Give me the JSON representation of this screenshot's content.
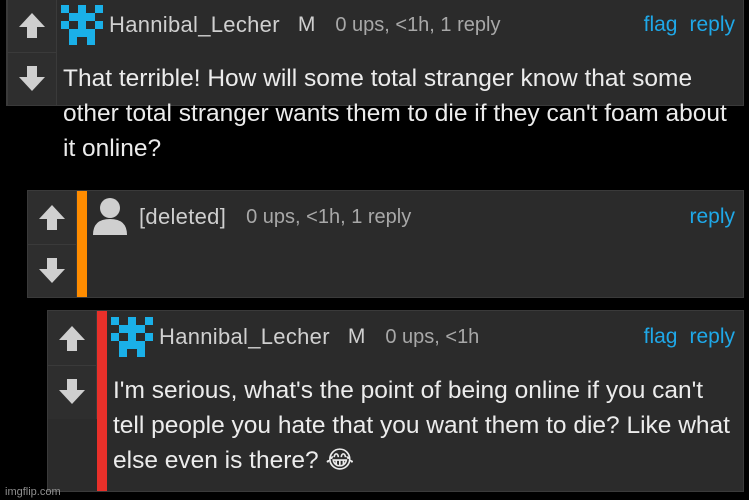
{
  "comments": [
    {
      "username": "Hannibal_Lecher",
      "badge": "M",
      "meta": "0 ups, <1h, 1 reply",
      "flag": "flag",
      "reply": "reply",
      "text": "That terrible! How will some total stranger know that some other total stranger wants them to die if they can't foam about it online?"
    },
    {
      "username": "[deleted]",
      "meta": "0 ups, <1h, 1 reply",
      "reply": "reply",
      "stripe_color": "#ff8c00"
    },
    {
      "username": "Hannibal_Lecher",
      "badge": "M",
      "meta": "0 ups, <1h",
      "flag": "flag",
      "reply": "reply",
      "text": "I'm serious, what's the point of being online if you can't tell people you hate that you want them to die? Like what else even is there? 😂",
      "stripe_color": "#e8302a"
    }
  ],
  "watermark": "imgflip.com",
  "colors": {
    "link": "#1fa8e8",
    "avatar": "#1ab0e8"
  }
}
